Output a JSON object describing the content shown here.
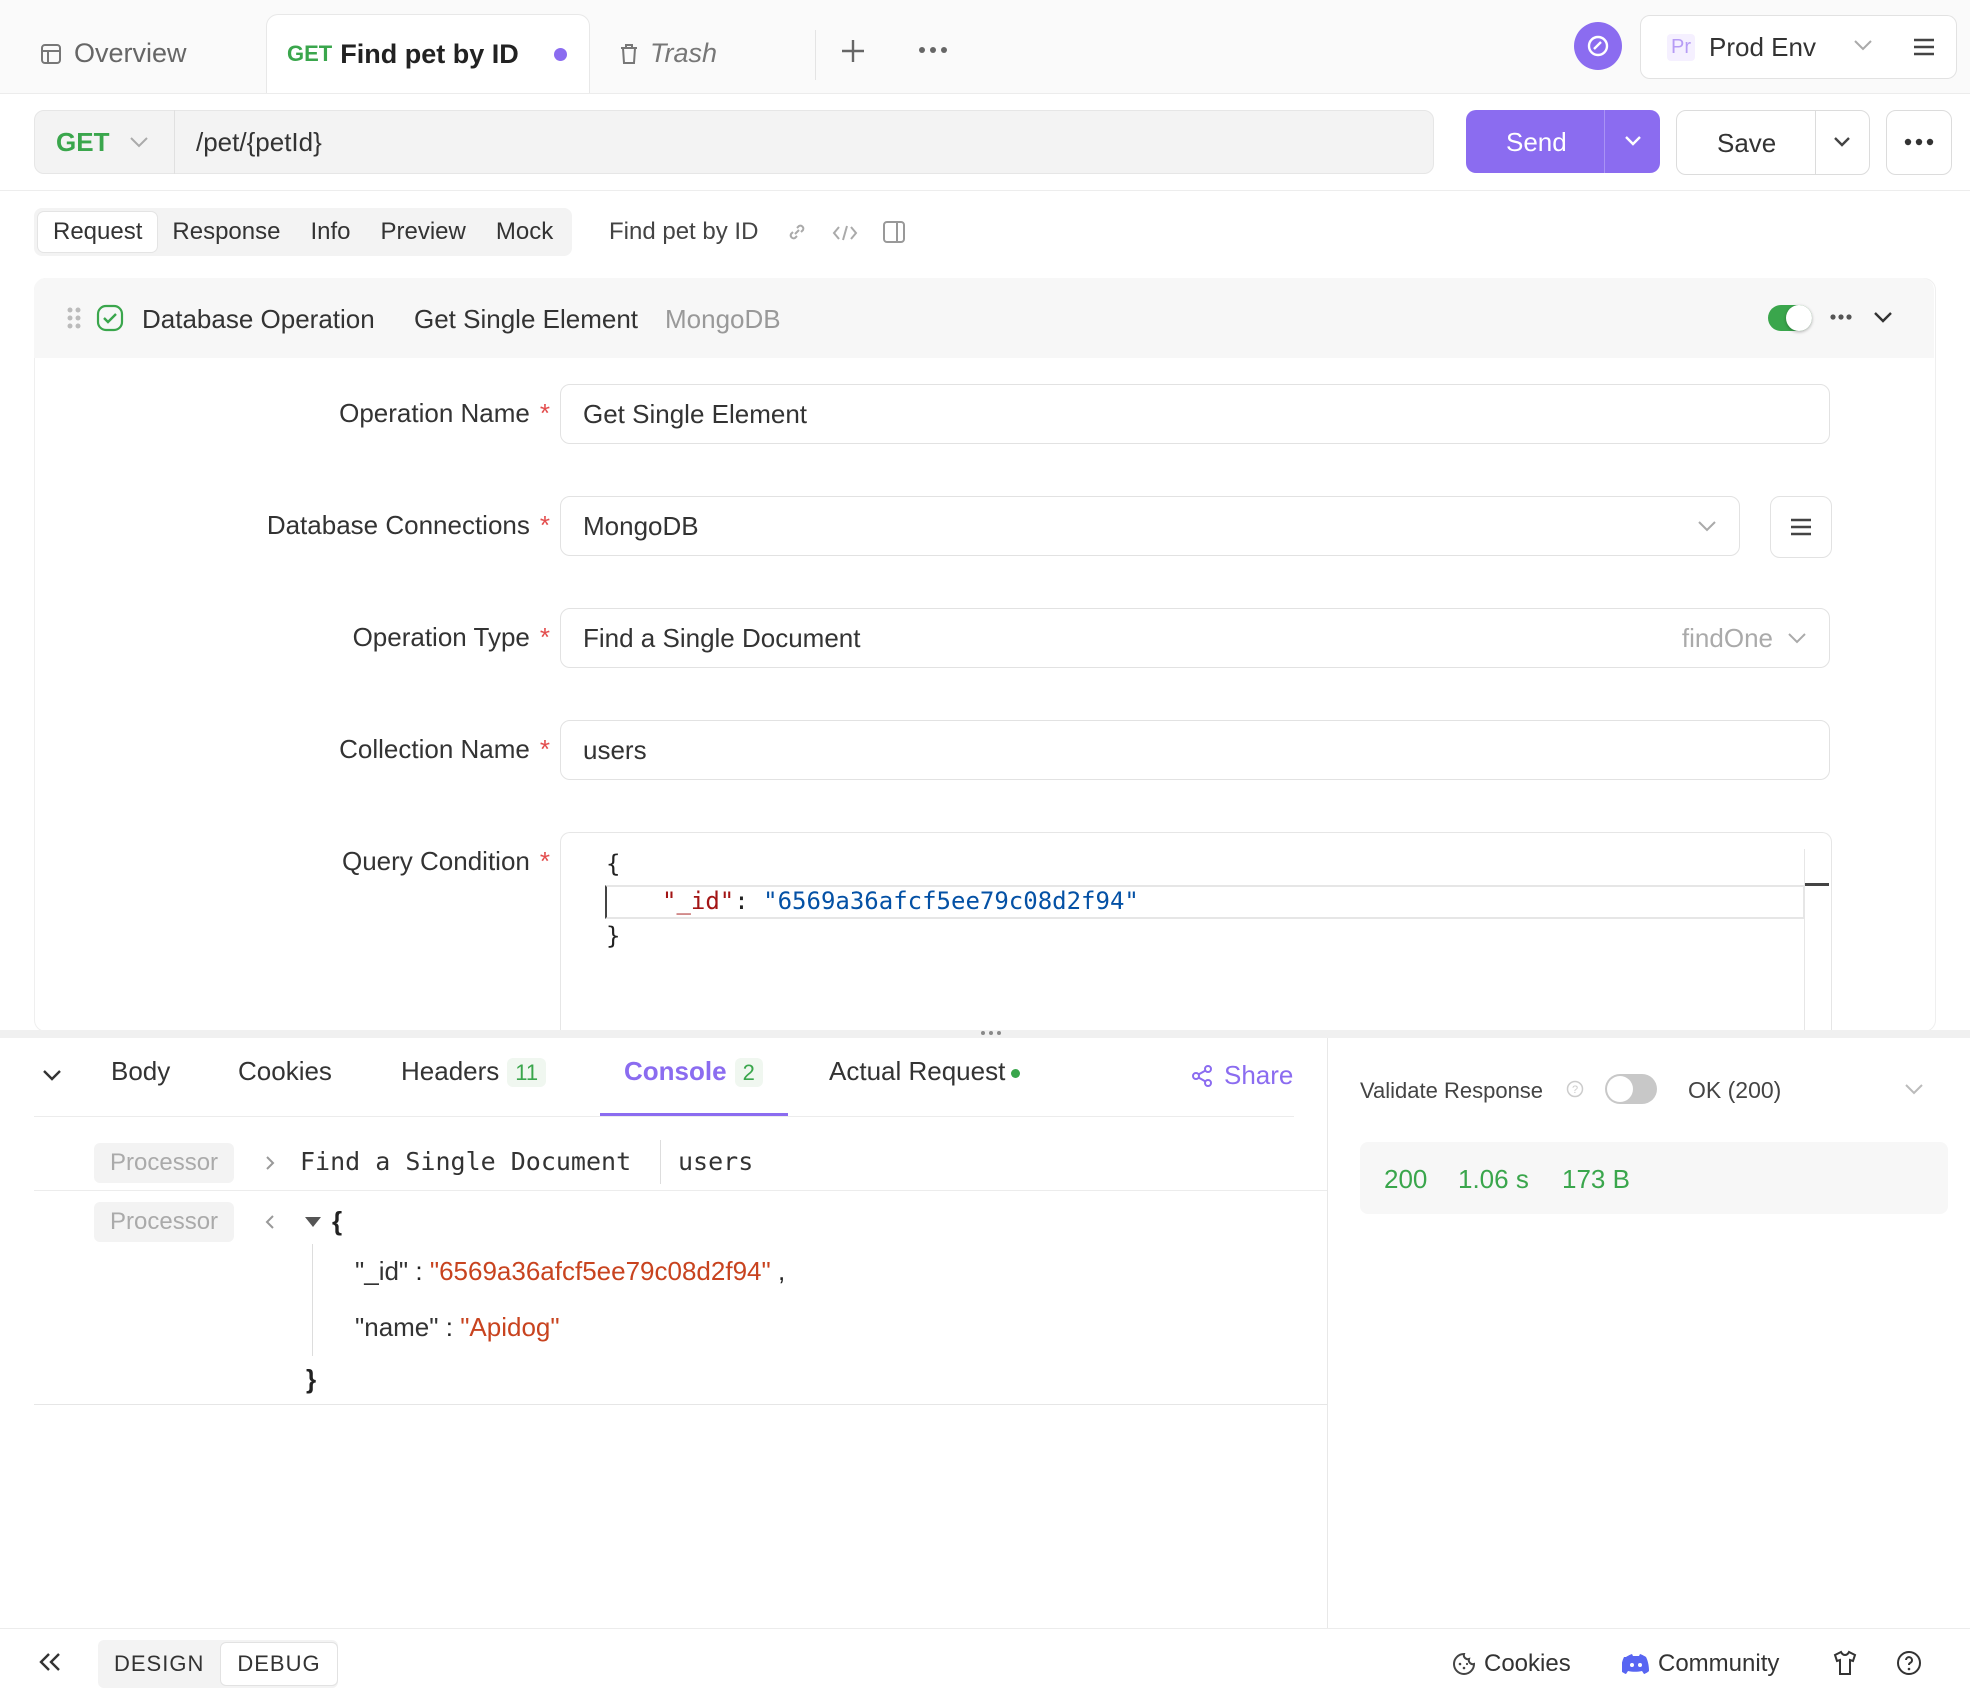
{
  "tabs": {
    "overview": "Overview",
    "active_method": "GET",
    "active_title": "Find pet by ID",
    "trash": "Trash"
  },
  "env": {
    "badge": "Pr",
    "name": "Prod Env"
  },
  "request_bar": {
    "method": "GET",
    "url": "/pet/{petId}",
    "send": "Send",
    "save": "Save"
  },
  "sub_tabs": {
    "items": [
      "Request",
      "Response",
      "Info",
      "Preview",
      "Mock"
    ],
    "endpoint_name": "Find pet by ID"
  },
  "processor": {
    "title": "Database Operation",
    "operation": "Get Single Element",
    "db": "MongoDB",
    "enabled": true
  },
  "form": {
    "operation_name": {
      "label": "Operation Name",
      "value": "Get Single Element",
      "required": "*"
    },
    "database_connections": {
      "label": "Database Connections",
      "value": "MongoDB",
      "required": "*"
    },
    "operation_type": {
      "label": "Operation Type",
      "value": "Find a Single Document",
      "hint": "findOne",
      "required": "*"
    },
    "collection_name": {
      "label": "Collection Name",
      "value": "users",
      "required": "*"
    },
    "query_condition": {
      "label": "Query Condition",
      "required": "*",
      "line1": "{",
      "key": "\"_id\"",
      "colon": ":",
      "value": "\"6569a36afcf5ee79c08d2f94\"",
      "line3": "}"
    }
  },
  "response_tabs": {
    "body": "Body",
    "cookies": "Cookies",
    "headers": "Headers",
    "headers_count": "11",
    "console": "Console",
    "console_count": "2",
    "actual_request": "Actual Request",
    "share": "Share"
  },
  "console": {
    "row1": {
      "chip": "Processor",
      "text1": "Find a Single Document",
      "text2": "users"
    },
    "row2": {
      "chip": "Processor",
      "open": "{",
      "k1": "\"_id\"",
      "v1": "\"6569a36afcf5ee79c08d2f94\"",
      "k2": "\"name\"",
      "v2": "\"Apidog\"",
      "close": "}",
      "sep": ":",
      "comma": ","
    }
  },
  "right_panel": {
    "validate": "Validate Response",
    "status_select": "OK (200)",
    "status": "200",
    "time": "1.06 s",
    "size": "173 B",
    "status_color": "#3aa64c"
  },
  "footer": {
    "design": "DESIGN",
    "debug": "DEBUG",
    "cookies": "Cookies",
    "community": "Community"
  },
  "colors": {
    "accent": "#8b6cf0",
    "get": "#3aa64c",
    "required": "#e34d4d"
  }
}
